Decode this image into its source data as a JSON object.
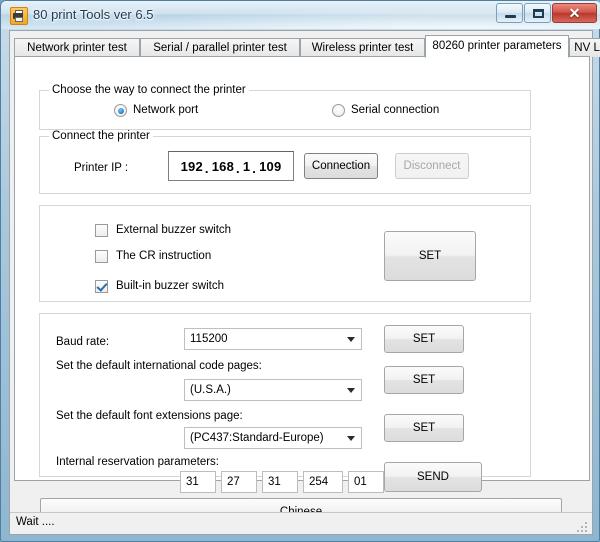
{
  "window": {
    "title": "80 print Tools ver 6.5",
    "icon": "printer-icon",
    "minimize_label": "–",
    "maximize_label": "□",
    "close_label": "✕"
  },
  "tabs": [
    {
      "label": "Network printer test",
      "active": false
    },
    {
      "label": "Serial / parallel printer test",
      "active": false
    },
    {
      "label": "Wireless printer test",
      "active": false
    },
    {
      "label": "80260 printer parameters",
      "active": true
    },
    {
      "label": "NV LOGO",
      "active": false
    }
  ],
  "connect_way": {
    "legend": "Choose the way to connect the printer",
    "options": [
      {
        "label": "Network port",
        "selected": true
      },
      {
        "label": "Serial connection",
        "selected": false
      }
    ]
  },
  "connect_printer": {
    "legend": "Connect the printer",
    "ip_label": "Printer IP :",
    "ip_octets": [
      "192",
      "168",
      "1",
      "109"
    ],
    "ip_value": "192.168.1.109",
    "connection_button": "Connection",
    "disconnect_button": "Disconnect",
    "disconnect_disabled": true
  },
  "switches": {
    "items": [
      {
        "label": "External buzzer switch",
        "checked": false
      },
      {
        "label": "The CR instruction",
        "checked": false
      },
      {
        "label": "Built-in buzzer switch",
        "checked": true
      }
    ],
    "set_button": "SET"
  },
  "parameters": {
    "baud_rate_label": "Baud rate:",
    "baud_rate_value": "115200",
    "baud_rate_set": "SET",
    "code_pages_label": "Set the default international code pages:",
    "code_pages_value": "(U.S.A.)",
    "code_pages_set": "SET",
    "font_ext_label": "Set the default font extensions page:",
    "font_ext_value": "(PC437:Standard-Europe)",
    "font_ext_set": "SET",
    "reservation_label": "Internal reservation parameters:",
    "reservation_values": [
      "31",
      "27",
      "31",
      "254",
      "01"
    ],
    "send_button": "SEND"
  },
  "language_button": "Chinese",
  "status": {
    "text": "Wait ...."
  },
  "colors": {
    "accent": "#1d7fc4",
    "close_red": "#b8392d",
    "window_border": "#4f7fa0",
    "client_bg": "#f0f0f0",
    "page_bg": "#ffffff"
  }
}
